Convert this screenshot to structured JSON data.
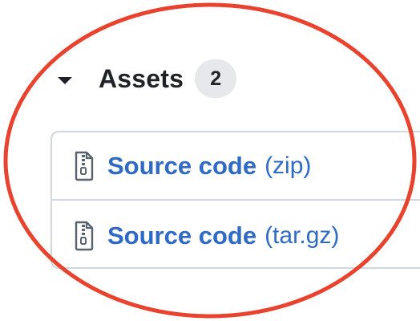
{
  "assets": {
    "title": "Assets",
    "count": "2",
    "items": [
      {
        "label": "Source code",
        "format": "(zip)",
        "icon": "file-zip-icon"
      },
      {
        "label": "Source code",
        "format": "(tar.gz)",
        "icon": "file-zip-icon"
      }
    ]
  },
  "colors": {
    "link": "#2f6ac5",
    "annotation": "#e8432e",
    "border": "#d0d7de",
    "badge_bg": "#e6e8eb",
    "text": "#1f2328"
  }
}
